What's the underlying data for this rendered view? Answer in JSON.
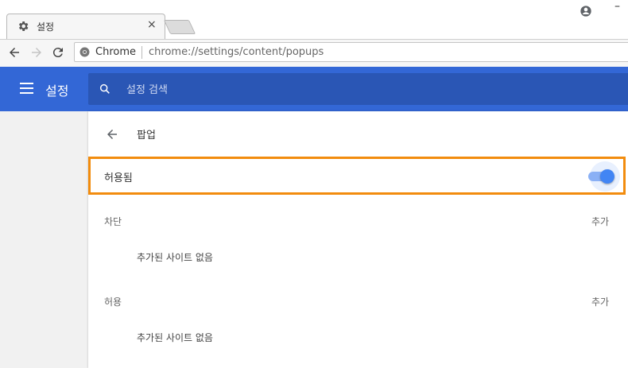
{
  "browser": {
    "tab_title": "설정",
    "tab_close": "×",
    "site_chip": "Chrome",
    "url": "chrome://settings/content/popups",
    "minimize": "–"
  },
  "header": {
    "title": "설정",
    "search_placeholder": "설정 검색"
  },
  "page": {
    "title": "팝업",
    "allowed_label": "허용됨",
    "allowed_state": true,
    "sections": [
      {
        "label": "차단",
        "add_label": "추가",
        "empty": "추가된 사이트 없음"
      },
      {
        "label": "허용",
        "add_label": "추가",
        "empty": "추가된 사이트 없음"
      }
    ]
  },
  "colors": {
    "accent": "#3367d6",
    "search_bg": "#2a56b5",
    "highlight": "#f28c0e",
    "toggle": "#4285f4"
  }
}
